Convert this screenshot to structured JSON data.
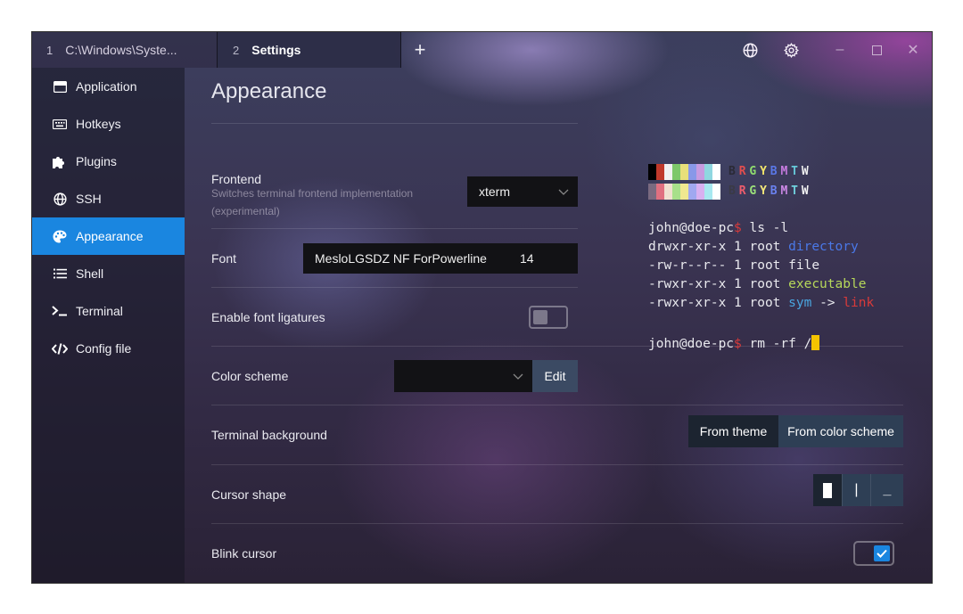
{
  "tabs": [
    {
      "number": "1",
      "title": "C:\\Windows\\Syste..."
    },
    {
      "number": "2",
      "title": "Settings"
    }
  ],
  "new_tab_label": "+",
  "window_controls": {
    "globe": "globe-icon",
    "settings": "gear-icon",
    "minimize": "–",
    "maximize": "☐",
    "close": "✕"
  },
  "sidebar": {
    "items": [
      {
        "label": "Application",
        "icon": "window-icon"
      },
      {
        "label": "Hotkeys",
        "icon": "keyboard-icon"
      },
      {
        "label": "Plugins",
        "icon": "puzzle-icon"
      },
      {
        "label": "SSH",
        "icon": "globe-icon"
      },
      {
        "label": "Appearance",
        "icon": "palette-icon",
        "active": true
      },
      {
        "label": "Shell",
        "icon": "list-icon"
      },
      {
        "label": "Terminal",
        "icon": "terminal-icon"
      },
      {
        "label": "Config file",
        "icon": "code-icon"
      }
    ]
  },
  "page": {
    "title": "Appearance",
    "frontend": {
      "label": "Frontend",
      "description": "Switches terminal frontend implementation (experimental)",
      "value": "xterm"
    },
    "font": {
      "label": "Font",
      "family": "MesloLGSDZ NF ForPowerline",
      "size": "14"
    },
    "ligatures": {
      "label": "Enable font ligatures",
      "enabled": false
    },
    "color_scheme": {
      "label": "Color scheme",
      "value": "",
      "edit_label": "Edit"
    },
    "terminal_background": {
      "label": "Terminal background",
      "options": [
        "From theme",
        "From color scheme"
      ],
      "selected": "From theme"
    },
    "cursor_shape": {
      "label": "Cursor shape",
      "options": [
        "block",
        "beam",
        "underline"
      ],
      "selected": "block",
      "beam_glyph": "|",
      "underline_glyph": "_"
    },
    "blink_cursor": {
      "label": "Blink cursor",
      "enabled": true
    }
  },
  "preview": {
    "palette_normal": [
      "#000000",
      "#c91b00",
      "#00c200",
      "#c7c400",
      "#4778f5",
      "#ca30c7",
      "#00c5c7",
      "#c7c7c7"
    ],
    "palette_bright": [
      "#686868",
      "#ff6e67",
      "#5ffa68",
      "#fffc67",
      "#6871ff",
      "#ff77ff",
      "#60fdff",
      "#ffffff"
    ],
    "swatch_colors_row1": [
      "#000000",
      "#c0392b",
      "#f1f1f1",
      "#7dc86a",
      "#e8e07a",
      "#8898e8",
      "#c79be0",
      "#8fd7e0",
      "#ffffff"
    ],
    "swatch_colors_row2": [
      "#7a6a80",
      "#e07080",
      "#f0e0d0",
      "#a8e08a",
      "#f0e890",
      "#a0a8f0",
      "#d8b0f0",
      "#a8e8f0",
      "#ffffff"
    ],
    "letters": [
      "B",
      "R",
      "G",
      "Y",
      "B",
      "M",
      "T",
      "W"
    ],
    "letter_colors": [
      "#2a2a35",
      "#e34e4e",
      "#8fdc6e",
      "#f2e56a",
      "#5a78e8",
      "#c77be0",
      "#66c8d8",
      "#f0f0f0"
    ],
    "letter_colors_bright": [
      "#3a3a45",
      "#ee5d6c",
      "#9be07a",
      "#f3e77a",
      "#6a82ef",
      "#cc88e6",
      "#70d0dc",
      "#f4f4f4"
    ],
    "lines": {
      "prompt1_user": "john@doe-pc",
      "prompt_symbol": "$",
      "prompt1_cmd": " ls -l",
      "line1_prefix": "drwxr-xr-x 1 root ",
      "line1_name": "directory",
      "line2": "-rw-r--r-- 1 root file",
      "line3_prefix": "-rwxr-xr-x 1 root ",
      "line3_name": "executable",
      "line4_prefix": "-rwxr-xr-x 1 root ",
      "line4_sym": "sym",
      "line4_arrow": " -> ",
      "line4_link": "link",
      "prompt2_user": "john@doe-pc",
      "prompt2_cmd": " rm -rf /"
    },
    "colors": {
      "directory": "#4a78e8",
      "executable": "#b6d85a",
      "sym": "#4aa6e0",
      "link": "#d93a3a",
      "prompt_symbol": "#d93a3a",
      "cursor": "#f5c400"
    }
  },
  "colors": {
    "accent": "#1a86e0",
    "button_dark": "#1c2430",
    "button_light": "#2e3f55"
  }
}
